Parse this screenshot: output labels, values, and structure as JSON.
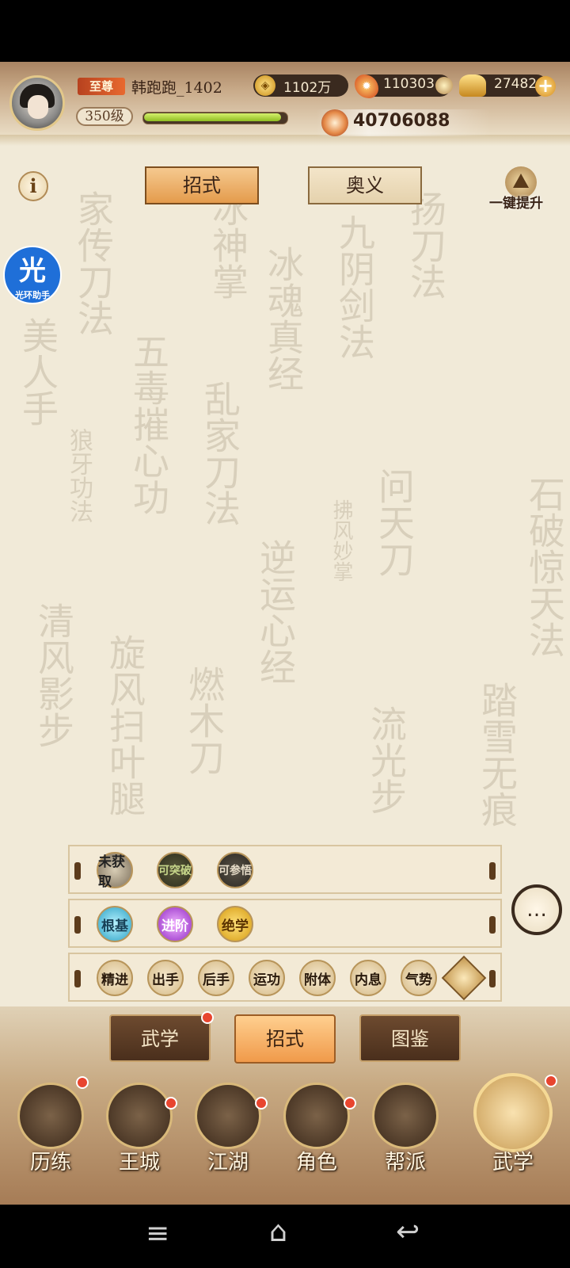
{
  "player": {
    "rank_badge": "至尊",
    "name": "韩跑跑_1402",
    "level": "350级",
    "xp_progress": 0.96,
    "power": "40706088"
  },
  "currencies": {
    "copper": "1102万",
    "fire": "110303",
    "gold": "27482"
  },
  "top_tabs": [
    "招式",
    "奥义"
  ],
  "top_tabs_active": 0,
  "upgrade_label": "一键提升",
  "helper": {
    "glyph": "光",
    "label": "光环助手"
  },
  "info_glyph": "i",
  "background_titles": [
    "家传刀法",
    "冰神掌",
    "冰魂真经",
    "九阴剑法",
    "扬刀法",
    "五毒摧心功",
    "问天刀",
    "石破惊天法",
    "乱家刀法",
    "拂风妙掌",
    "逆运心经",
    "踏雪无痕",
    "美人手",
    "狼牙功法",
    "燃木刀",
    "旋风扫叶腿",
    "流光步",
    "清风影步"
  ],
  "filters": {
    "row1": [
      "未获取",
      "可突破",
      "可参悟"
    ],
    "row2": [
      "根基",
      "进阶",
      "绝学"
    ],
    "row3": [
      "精进",
      "出手",
      "后手",
      "运功",
      "附体",
      "内息",
      "气势"
    ]
  },
  "bottom_tabs": [
    "武学",
    "招式",
    "图鉴"
  ],
  "bottom_tabs_active": 1,
  "nav": [
    "历练",
    "王城",
    "江湖",
    "角色",
    "帮派",
    "武学"
  ],
  "nav_active": 5,
  "colors": {
    "accent": "#e49b4c",
    "badge": "#e8452f",
    "background": "#f1ead8"
  }
}
